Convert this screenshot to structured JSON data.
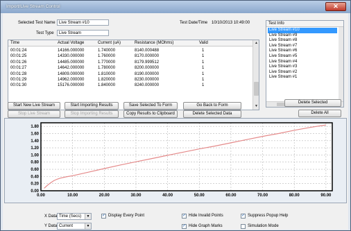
{
  "window": {
    "title": "Import/Live Stream Control",
    "close_glyph": "✕"
  },
  "header": {
    "selected_test_label": "Selected Test Name",
    "selected_test_value": "Live Stream #10",
    "test_type_label": "Test Type",
    "test_type_value": "Live Stream",
    "test_datetime_label": "Test Date/Time",
    "test_datetime_value": "10/10/2013 10:49:00"
  },
  "grid": {
    "columns": [
      "Time",
      "Actual Voltage",
      "Current (uA)",
      "Resistance (MOhms)",
      "Valid"
    ],
    "rows": [
      [
        "00:01:24",
        "14166.000000",
        "1.740000",
        "8140.000488",
        "1"
      ],
      [
        "00:01:25",
        "14330.000000",
        "1.760000",
        "8170.000000",
        "1"
      ],
      [
        "00:01:26",
        "14485.000000",
        "1.770000",
        "8179.999512",
        "1"
      ],
      [
        "00:01:27",
        "14642.000000",
        "1.780000",
        "8200.000000",
        "1"
      ],
      [
        "00:01:28",
        "14809.000000",
        "1.810000",
        "8190.000000",
        "1"
      ],
      [
        "00:01:29",
        "14962.000000",
        "1.820000",
        "8230.000000",
        "1"
      ],
      [
        "00:01:30",
        "15176.000000",
        "1.840000",
        "8240.000000",
        "1"
      ]
    ]
  },
  "test_info": {
    "header": "Test Info",
    "items": [
      "Live Stream #10",
      "Live Stream #9",
      "Live Stream #8",
      "Live Stream #7",
      "Live Stream #6",
      "Live Stream #5",
      "Live Stream #4",
      "Live Stream #3",
      "Live Stream #2",
      "Live Stream #1"
    ],
    "selected_index": 0
  },
  "buttons": {
    "start_live": "Start New Live Stream",
    "start_import": "Start Importing Results",
    "save_form": "Save Selected To Form",
    "go_back": "Go Back to Form",
    "delete_selected": "Delete Selected",
    "stop_live": "Stop Live Stream",
    "stop_import": "Stop Importing Results",
    "copy_clipboard": "Copy Results to Clipboard",
    "delete_selected_data": "Delete Selected Data",
    "delete_all": "Delete All"
  },
  "controls": {
    "x_data_label": "X Data",
    "x_data_value": "Time (Secs)",
    "y_data_label": "Y Data",
    "y_data_value": "Current",
    "display_every_point": "Display Every Point",
    "hide_invalid_points": "Hide Invalid Points",
    "suppress_popup_help": "Suppress Popup Help",
    "hide_graph_marks": "Hide Graph Marks",
    "simulation_mode": "Simulation Mode",
    "display_every_point_checked": true,
    "hide_invalid_points_checked": true,
    "suppress_popup_help_checked": true,
    "hide_graph_marks_checked": true,
    "simulation_mode_checked": false,
    "check_glyph": "✓",
    "dropdown_glyph": "▼"
  },
  "chart_data": {
    "type": "line",
    "x_ticks": [
      "0.00",
      "10.00",
      "20.00",
      "30.00",
      "40.00",
      "50.00",
      "60.00",
      "70.00",
      "80.00",
      "90.00"
    ],
    "y_ticks": [
      "0.00",
      "0.20",
      "0.40",
      "0.60",
      "0.80",
      "1.00",
      "1.20",
      "1.40",
      "1.60",
      "1.80"
    ],
    "xlim": [
      0,
      92
    ],
    "ylim": [
      0,
      1.9
    ],
    "grid": true,
    "line_color": "#e58a8a",
    "x": [
      1,
      2,
      3,
      4,
      5,
      6,
      8,
      10,
      15,
      20,
      25,
      30,
      35,
      40,
      45,
      50,
      55,
      60,
      65,
      70,
      75,
      80,
      85,
      90
    ],
    "y": [
      0.07,
      0.15,
      0.22,
      0.28,
      0.32,
      0.35,
      0.39,
      0.42,
      0.52,
      0.62,
      0.72,
      0.81,
      0.9,
      0.99,
      1.08,
      1.17,
      1.25,
      1.34,
      1.43,
      1.52,
      1.6,
      1.69,
      1.77,
      1.84
    ]
  }
}
